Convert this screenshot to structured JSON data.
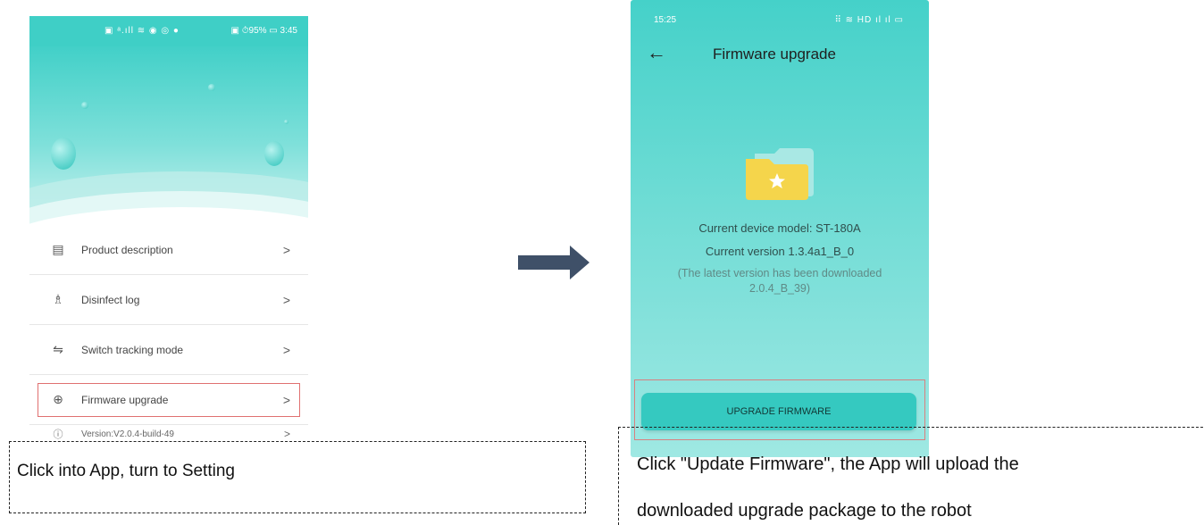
{
  "left_phone": {
    "status_icons_left": "▣ ᵃ.ıll ≋ ◉ ◎ ●",
    "status_right": "▣ ⏱95% ▭ 3:45",
    "menu": [
      {
        "icon": "book-icon",
        "glyph": "▤",
        "label": "Product description"
      },
      {
        "icon": "disinfect-icon",
        "glyph": "♗",
        "label": "Disinfect log"
      },
      {
        "icon": "switch-icon",
        "glyph": "⇋",
        "label": "Switch tracking mode"
      },
      {
        "icon": "upload-circle-icon",
        "glyph": "⊕",
        "label": "Firmware upgrade"
      }
    ],
    "version_label": "Version:V2.0.4-build-49",
    "chevron": ">"
  },
  "right_phone": {
    "time": "15:25",
    "status_icons": "⠿ ≋ HD ıl ıl ▭",
    "back_glyph": "←",
    "title": "Firmware upgrade",
    "device_model": "Current device model: ST-180A",
    "current_version": "Current version 1.3.4a1_B_0",
    "latest_note": "(The latest version has been downloaded 2.0.4_B_39)",
    "upgrade_button": "UPGRADE FIRMWARE"
  },
  "captions": {
    "left": "Click into App, turn to Setting",
    "right_line1": "Click \"Update Firmware\", the App will upload the",
    "right_line2": "downloaded upgrade package to the robot"
  },
  "colors": {
    "teal": "#3fcfc6",
    "highlight": "#e07070",
    "arrow": "#3f5068"
  }
}
